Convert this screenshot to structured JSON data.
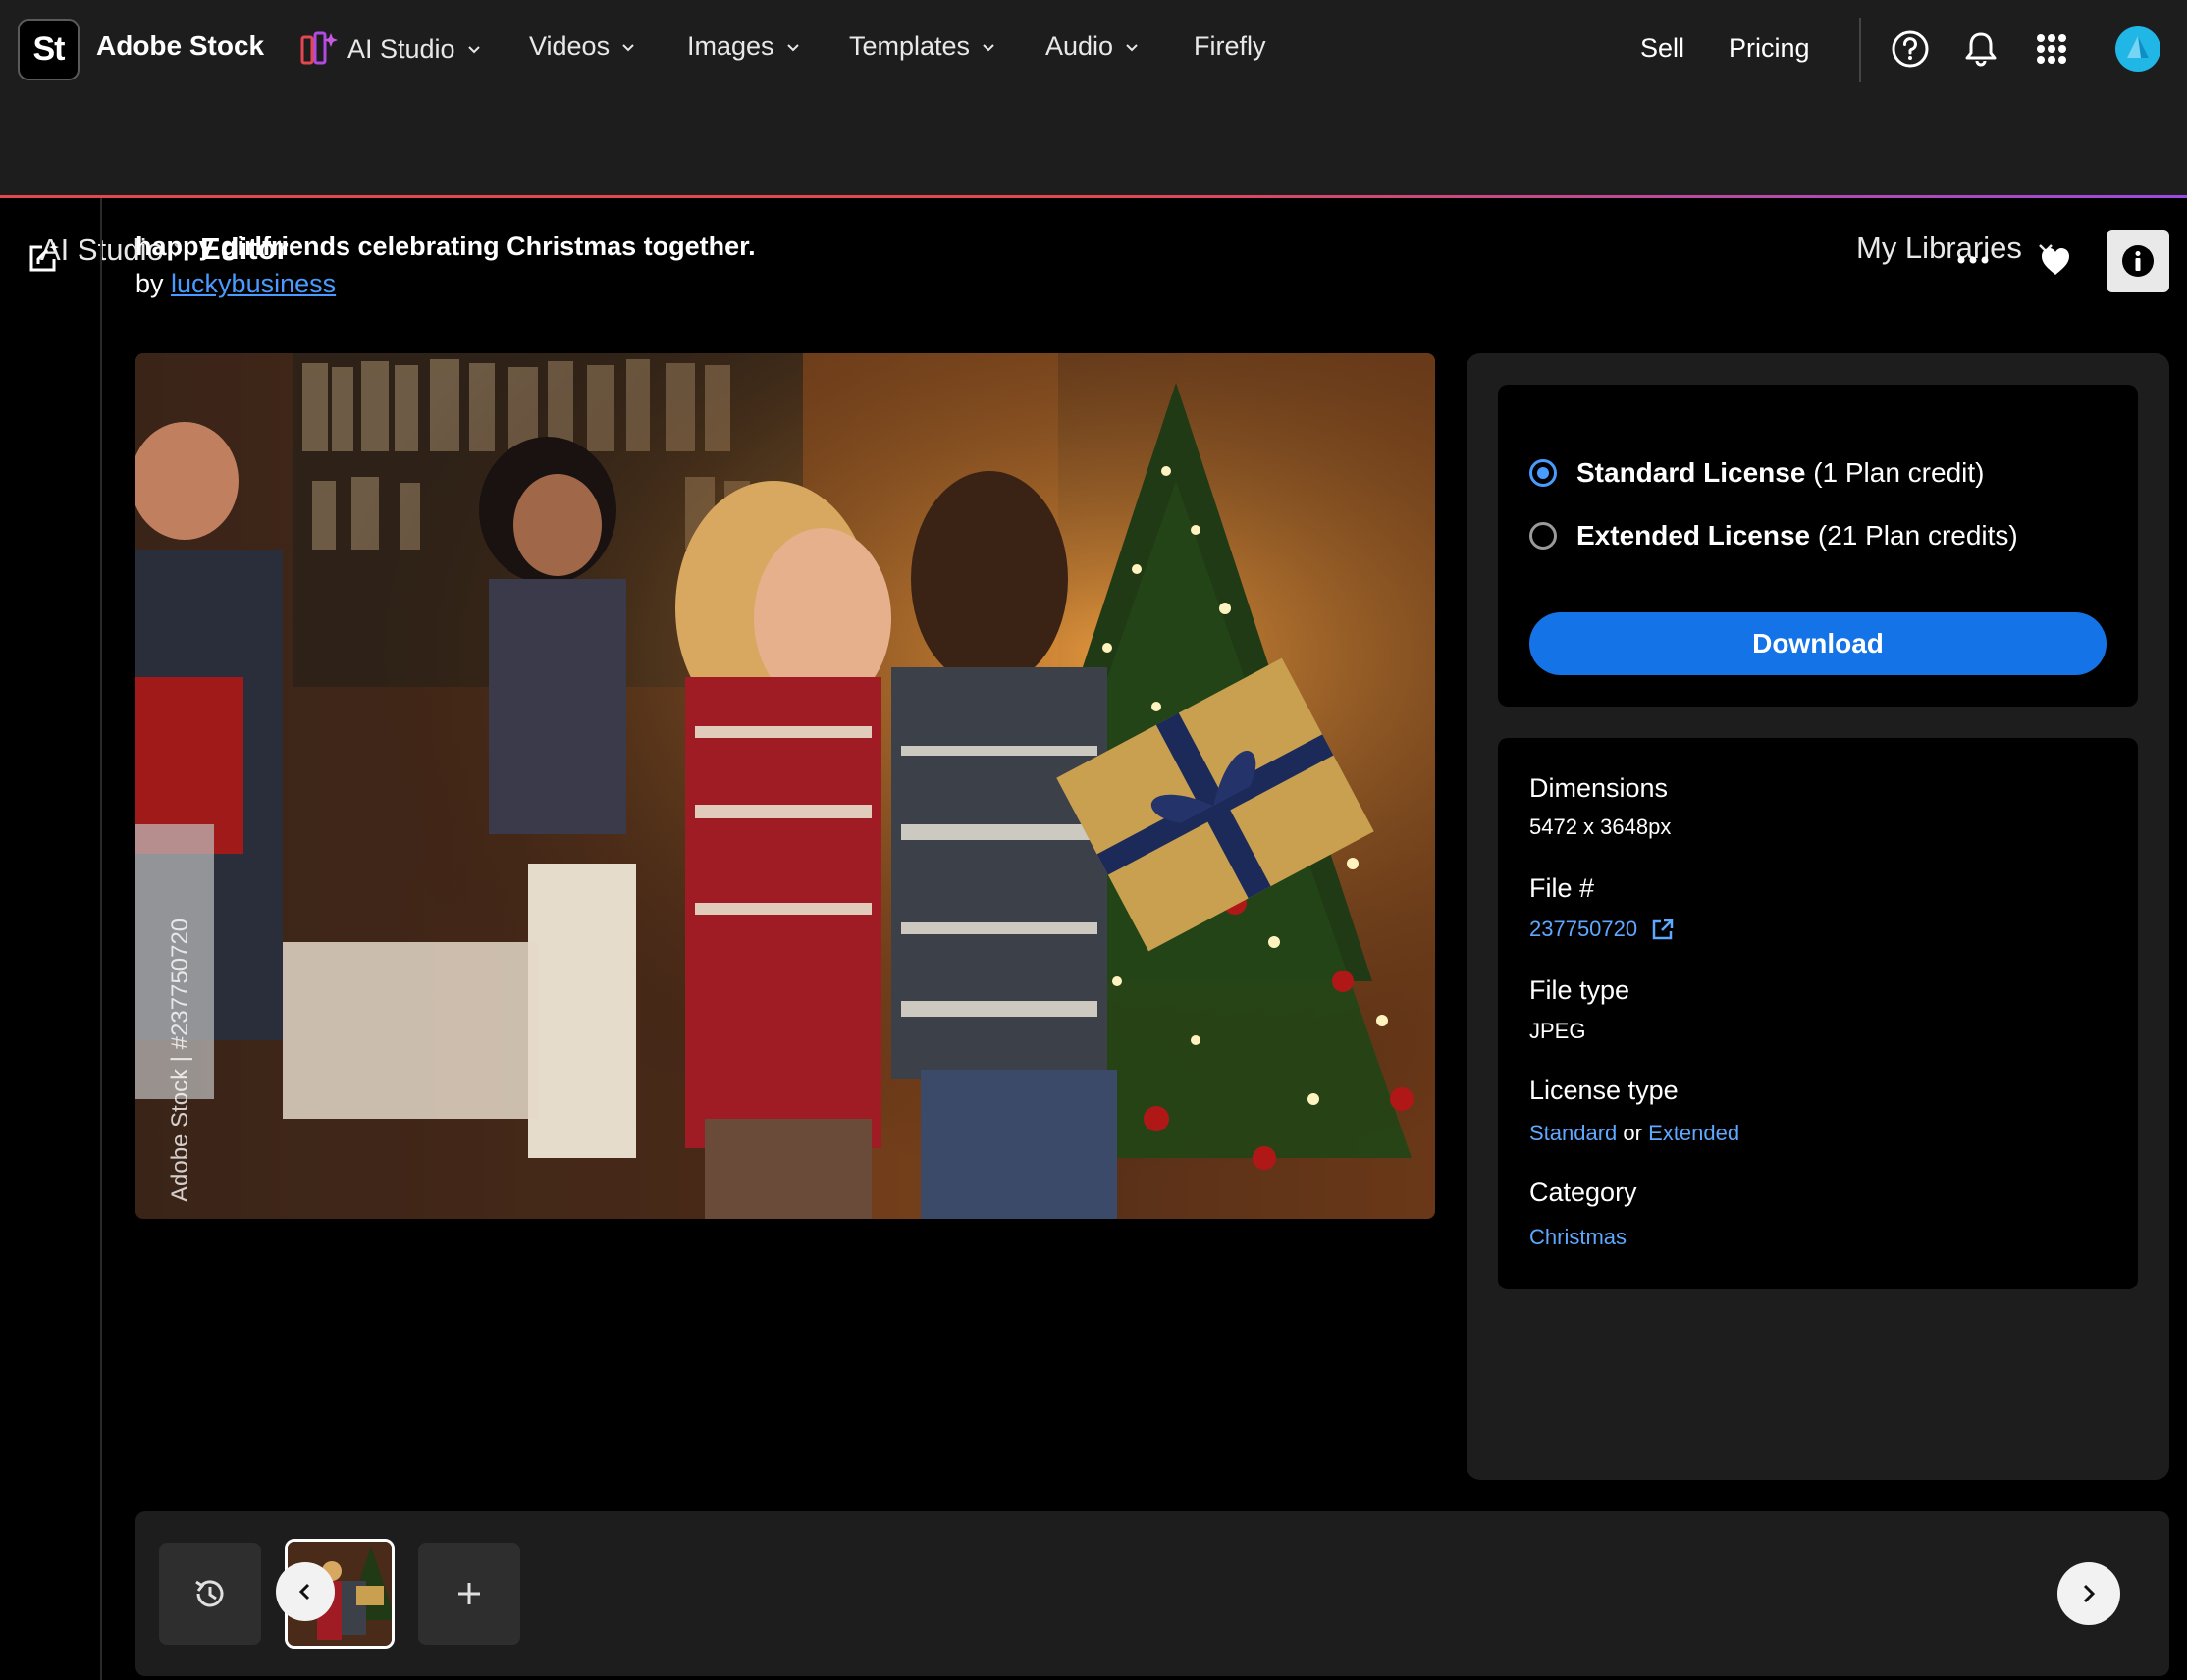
{
  "app": {
    "logo_text": "St",
    "brand": "Adobe Stock"
  },
  "nav": {
    "items": [
      {
        "label": "AI Studio",
        "has_dropdown": true
      },
      {
        "label": "Videos",
        "has_dropdown": true
      },
      {
        "label": "Images",
        "has_dropdown": true
      },
      {
        "label": "Templates",
        "has_dropdown": true
      },
      {
        "label": "Audio",
        "has_dropdown": true
      },
      {
        "label": "Firefly",
        "has_dropdown": false
      }
    ],
    "sell": "Sell",
    "pricing": "Pricing",
    "icons": [
      "help-icon",
      "bell-icon",
      "apps-grid-icon",
      "avatar"
    ]
  },
  "breadcrumb": {
    "parent": "AI Studio",
    "current": "Editor"
  },
  "libraries": {
    "label": "My Libraries"
  },
  "asset": {
    "title": "happy girlfriends celebrating Christmas together.",
    "by_prefix": "by",
    "author": "luckybusiness",
    "watermark": "Adobe Stock | #237750720"
  },
  "license": {
    "options": [
      {
        "name": "Standard License",
        "credits": "(1 Plan credit)",
        "selected": true
      },
      {
        "name": "Extended License",
        "credits": "(21 Plan credits)",
        "selected": false
      }
    ],
    "download_label": "Download"
  },
  "details": {
    "dimensions_label": "Dimensions",
    "dimensions_value": "5472 x 3648px",
    "file_label": "File #",
    "file_value": "237750720",
    "filetype_label": "File type",
    "filetype_value": "JPEG",
    "licensetype_label": "License type",
    "licensetype_standard": "Standard",
    "licensetype_or": "or",
    "licensetype_extended": "Extended",
    "category_label": "Category",
    "category_value": "Christmas"
  },
  "colors": {
    "accent": "#1473e6",
    "link": "#5ea8ff",
    "bar": "#1d1d1d",
    "divider_gradient": [
      "#e34850",
      "#9b4ae0"
    ]
  }
}
